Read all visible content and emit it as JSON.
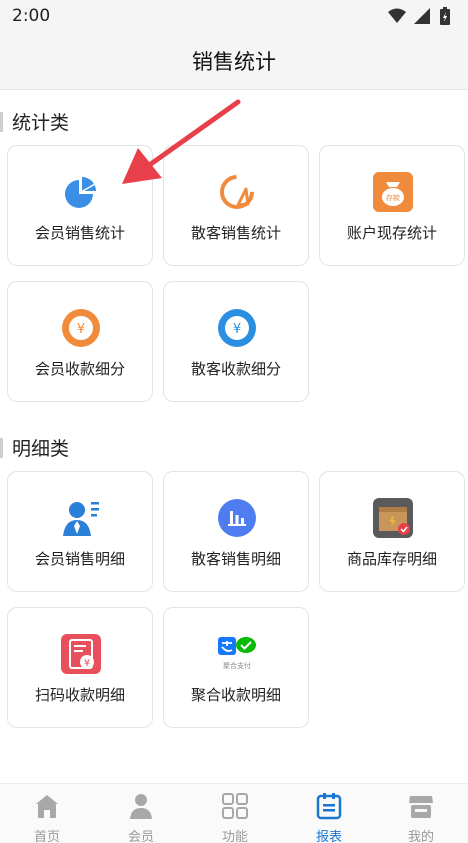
{
  "status_bar": {
    "time": "2:00"
  },
  "header": {
    "title": "销售统计"
  },
  "sections": [
    {
      "title": "统计类",
      "items": [
        {
          "label": "会员销售统计",
          "icon": "pie-chart-icon"
        },
        {
          "label": "散客销售统计",
          "icon": "broken-circle-icon"
        },
        {
          "label": "账户现存统计",
          "icon": "money-bag-icon",
          "icon_text": "存款"
        },
        {
          "label": "会员收款细分",
          "icon": "yuan-coin-orange-icon",
          "icon_text": "¥"
        },
        {
          "label": "散客收款细分",
          "icon": "yuan-coin-blue-icon",
          "icon_text": "¥"
        }
      ]
    },
    {
      "title": "明细类",
      "items": [
        {
          "label": "会员销售明细",
          "icon": "member-list-icon"
        },
        {
          "label": "散客销售明细",
          "icon": "bar-chart-icon"
        },
        {
          "label": "商品库存明细",
          "icon": "stock-box-icon"
        },
        {
          "label": "扫码收款明细",
          "icon": "scan-receipt-icon",
          "icon_text": "¥"
        },
        {
          "label": "聚合收款明细",
          "icon": "aggregate-pay-icon",
          "icon_text": "聚合支付"
        }
      ]
    }
  ],
  "tabs": [
    {
      "label": "首页",
      "icon": "home-icon",
      "active": false
    },
    {
      "label": "会员",
      "icon": "person-icon",
      "active": false
    },
    {
      "label": "功能",
      "icon": "grid-icon",
      "active": false
    },
    {
      "label": "报表",
      "icon": "report-icon",
      "active": true
    },
    {
      "label": "我的",
      "icon": "store-icon",
      "active": false
    }
  ],
  "colors": {
    "active_tab": "#1976d2",
    "inactive_tab": "#9a9a9a",
    "arrow": "#e8404b"
  }
}
